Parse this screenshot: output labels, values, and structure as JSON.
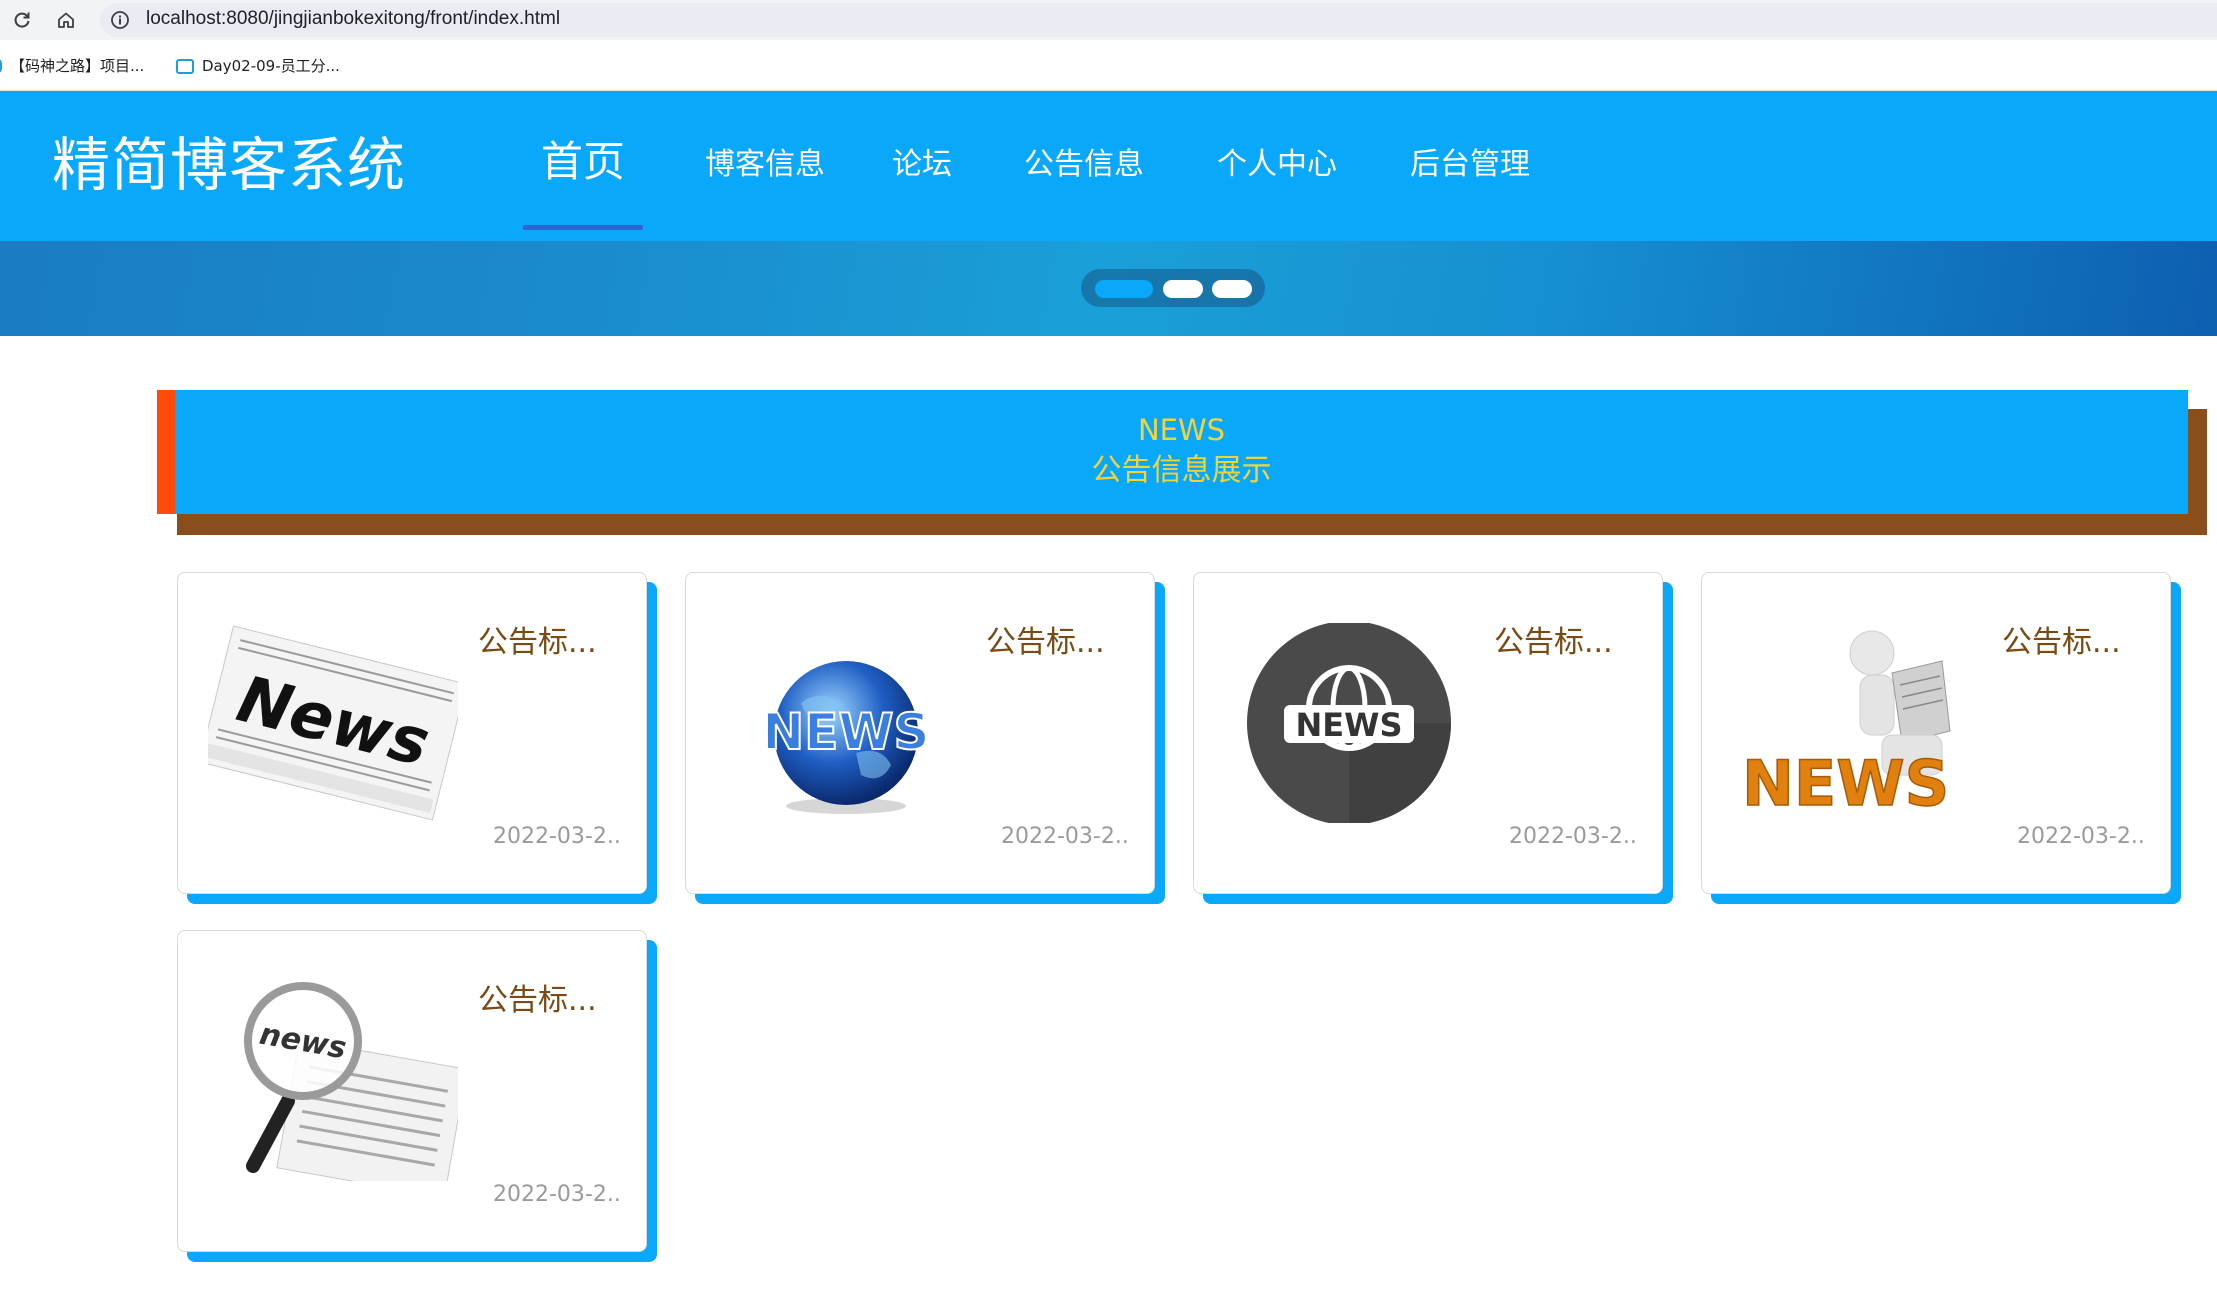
{
  "browser": {
    "url": "localhost:8080/jingjianbokexitong/front/index.html",
    "bookmarks": [
      {
        "label": "【码神之路】项目..."
      },
      {
        "label": "Day02-09-员工分..."
      }
    ],
    "icons": [
      "reload-icon",
      "home-icon",
      "info-icon"
    ]
  },
  "site": {
    "logo": "精简博客系统",
    "nav": [
      {
        "label": "首页",
        "active": true
      },
      {
        "label": "博客信息"
      },
      {
        "label": "论坛"
      },
      {
        "label": "公告信息"
      },
      {
        "label": "个人中心"
      },
      {
        "label": "后台管理"
      }
    ]
  },
  "carousel": {
    "slides": 3,
    "active_index": 0
  },
  "section": {
    "title_en": "NEWS",
    "title_cn": "公告信息展示"
  },
  "cards": [
    {
      "title": "公告标...",
      "date": "2022-03-2..",
      "image": "newspaper-news-image"
    },
    {
      "title": "公告标...",
      "date": "2022-03-2..",
      "image": "globe-news-image"
    },
    {
      "title": "公告标...",
      "date": "2022-03-2..",
      "image": "world-news-circle-image"
    },
    {
      "title": "公告标...",
      "date": "2022-03-2..",
      "image": "person-reading-news-image"
    },
    {
      "title": "公告标...",
      "date": "2022-03-2..",
      "image": "magnifier-news-image"
    }
  ],
  "colors": {
    "header": "#09a8fa",
    "section_accent": "#ff4b0a",
    "section_shadow": "#8a4e1c",
    "section_text": "#f2d33a",
    "card_title": "#7a4a12",
    "nav_underline": "#3a5fcf"
  }
}
